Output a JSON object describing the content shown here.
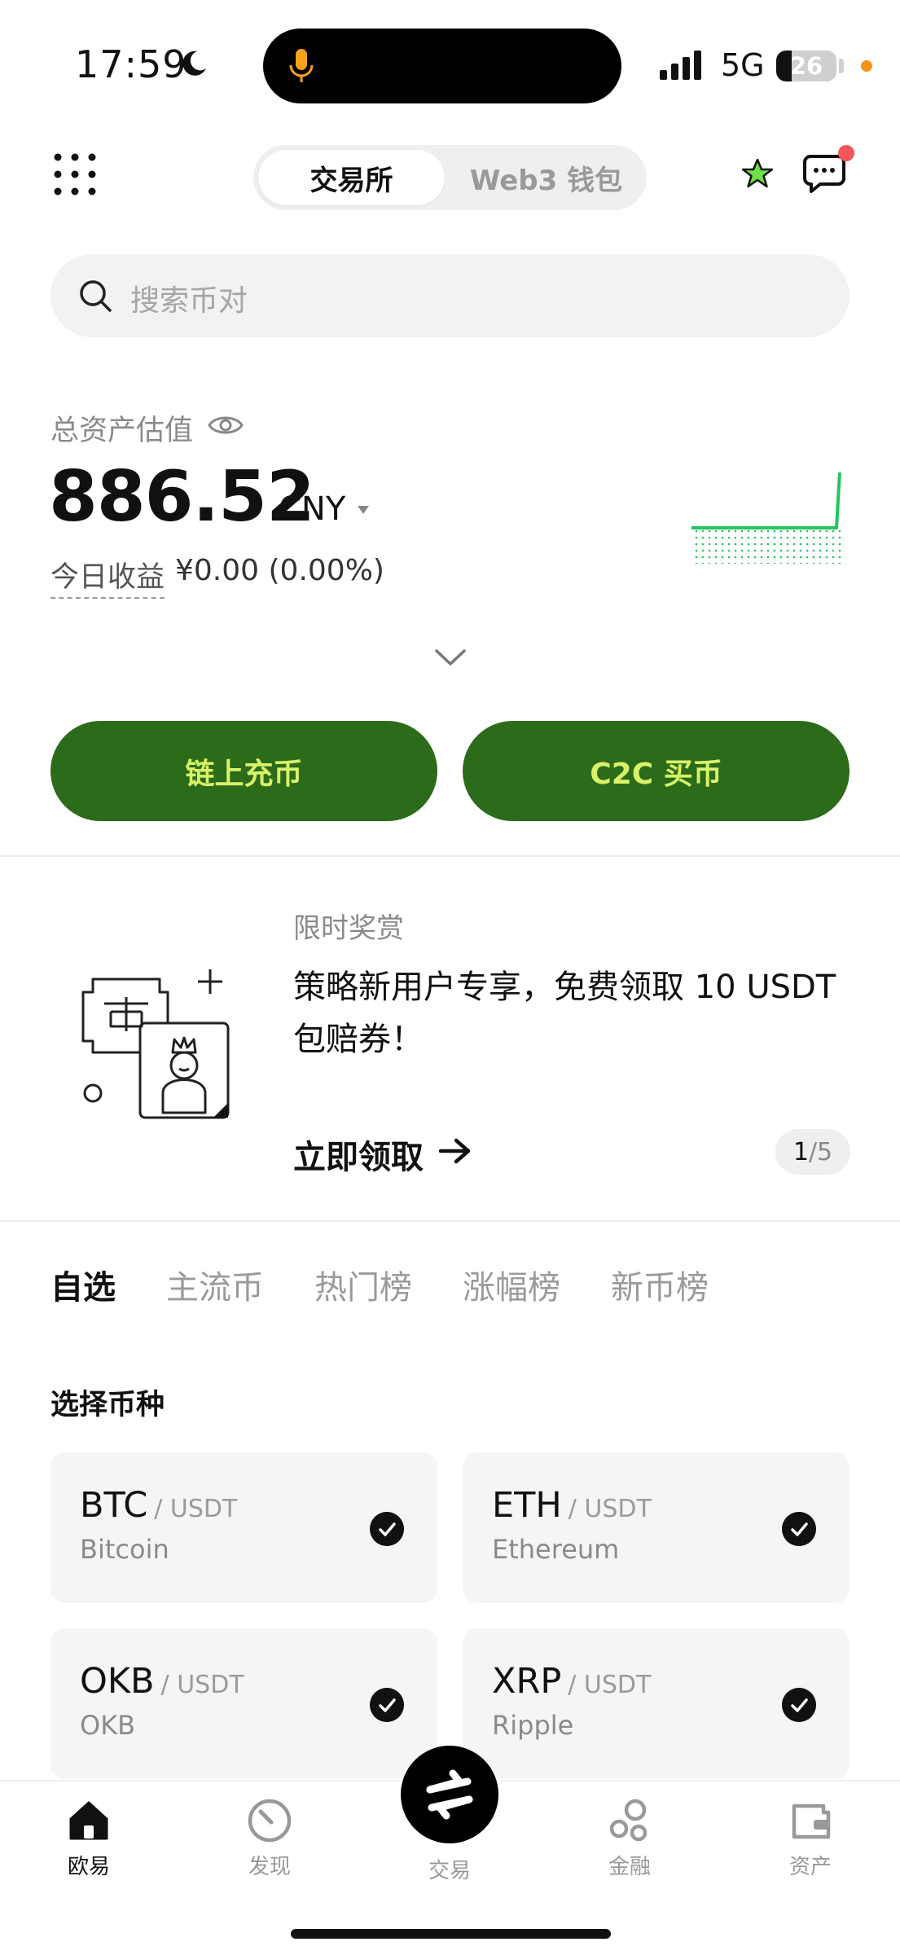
{
  "status_bar": {
    "time": "17:59",
    "network": "5G",
    "battery": "26",
    "battery_level": 0.26
  },
  "header": {
    "segment_active": "交易所",
    "segment_inactive": "Web3 钱包"
  },
  "search": {
    "placeholder": "搜索币对"
  },
  "assets": {
    "label": "总资产估值",
    "value": "886.52",
    "currency": "CNY",
    "pnl_label": "今日收益",
    "pnl_value": "¥0.00 (0.00%)"
  },
  "actions": {
    "deposit": "链上充币",
    "buy": "C2C 买币"
  },
  "promo": {
    "tag": "限时奖赏",
    "title": "策略新用户专享，免费领取 10 USDT 包赔券！",
    "cta": "立即领取",
    "page_current": "1",
    "page_total": "/5"
  },
  "market_tabs": [
    "自选",
    "主流币",
    "热门榜",
    "涨幅榜",
    "新币榜"
  ],
  "watchlist": {
    "title": "选择币种",
    "items": [
      {
        "symbol": "BTC",
        "quote": "/ USDT",
        "name": "Bitcoin"
      },
      {
        "symbol": "ETH",
        "quote": "/ USDT",
        "name": "Ethereum"
      },
      {
        "symbol": "OKB",
        "quote": "/ USDT",
        "name": "OKB"
      },
      {
        "symbol": "XRP",
        "quote": "/ USDT",
        "name": "Ripple"
      }
    ]
  },
  "bottom_nav": [
    {
      "label": "欧易",
      "icon": "home-icon"
    },
    {
      "label": "发现",
      "icon": "discover-icon"
    },
    {
      "label": "交易",
      "icon": "swap-icon"
    },
    {
      "label": "金融",
      "icon": "finance-icon"
    },
    {
      "label": "资产",
      "icon": "wallet-icon"
    }
  ],
  "colors": {
    "brand_green": "#2b6b19",
    "button_text": "#d9f26a",
    "spark_green": "#22c55e",
    "notify_red": "#f2555a"
  }
}
